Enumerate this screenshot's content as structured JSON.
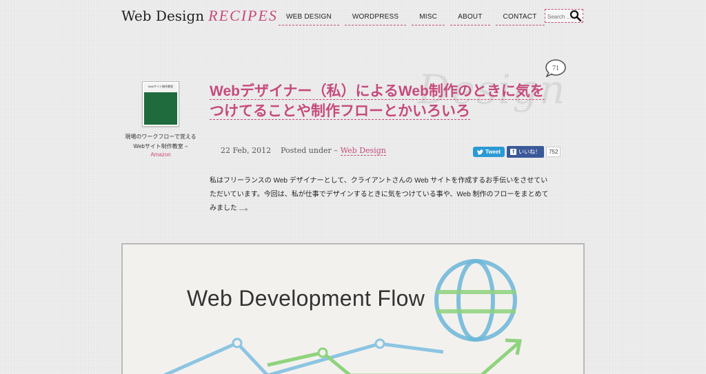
{
  "header": {
    "logo_main": "Web Design",
    "logo_accent": "RECIPES",
    "nav": [
      "WEB DESIGN",
      "WORDPRESS",
      "MISC",
      "ABOUT",
      "CONTACT"
    ],
    "search_placeholder": "Search ..."
  },
  "sidebar": {
    "book_cover_text": "Webサイト制作教室",
    "book_caption": "現場のワークフローで覚えるWebサイト制作教室 –",
    "book_link": "Amazon"
  },
  "post": {
    "title_line1": "Webデザイナー（私）によるWeb制作のときに気を",
    "title_line2": "つけてることや制作フローとかいろいろ",
    "watermark": "Design",
    "comment_count": "71",
    "date": "22 Feb, 2012",
    "posted_under": "Posted under –",
    "category": "Web Design",
    "tweet_label": "Tweet",
    "like_label": "いいね！",
    "like_count": "752",
    "excerpt": "私はフリーランスの Web デザイナーとして、クライアントさんの Web サイトを作成するお手伝いをさせていただいています。今回は、私が仕事でデザインするときに気をつけている事や、Web 制作のフローをまとめてみました ...。"
  },
  "hero": {
    "title": "Web Development Flow"
  },
  "colors": {
    "accent": "#c64a7c",
    "twitter": "#2b9ad4",
    "facebook": "#3b5998",
    "globe": "#6ab6d8",
    "flow_green": "#8fd37e",
    "flow_blue": "#8cc5e2"
  }
}
